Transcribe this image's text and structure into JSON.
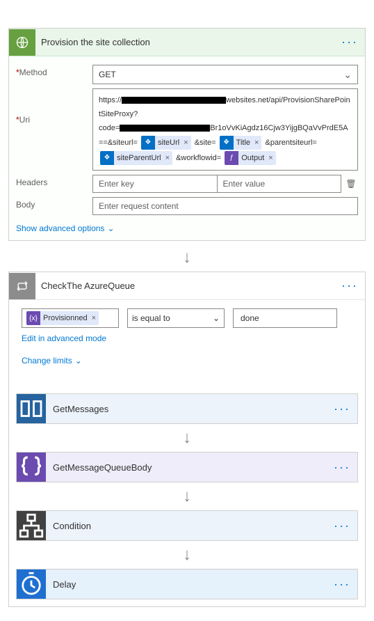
{
  "provision": {
    "title": "Provision the site collection",
    "method_label": "Method",
    "method_value": "GET",
    "uri_label": "Uri",
    "uri_parts": {
      "p1": "https://",
      "p2": "websites.net/api/ProvisionSharePointSiteProxy?",
      "p3": "code=",
      "p4": "Br1oVvKiAgdz16Cjw3YijgBQaVvPrdE5A==&siteurl=",
      "p5": " &site=",
      "p6": " &parentsiteurl=",
      "p7": " &workflowid="
    },
    "tokens": {
      "siteUrl": "siteUrl",
      "title": "Title",
      "siteParentUrl": "siteParentUrl",
      "output": "Output"
    },
    "headers_label": "Headers",
    "headers_key_ph": "Enter key",
    "headers_val_ph": "Enter value",
    "body_label": "Body",
    "body_ph": "Enter request content",
    "advanced": "Show advanced options"
  },
  "check": {
    "title": "CheckThe AzureQueue",
    "token": "Provisionned",
    "op": "is equal to",
    "val": "done",
    "edit": "Edit in advanced mode",
    "limits": "Change limits"
  },
  "steps": {
    "s1": "GetMessages",
    "s2": "GetMessageQueueBody",
    "s3": "Condition",
    "s4": "Delay"
  }
}
